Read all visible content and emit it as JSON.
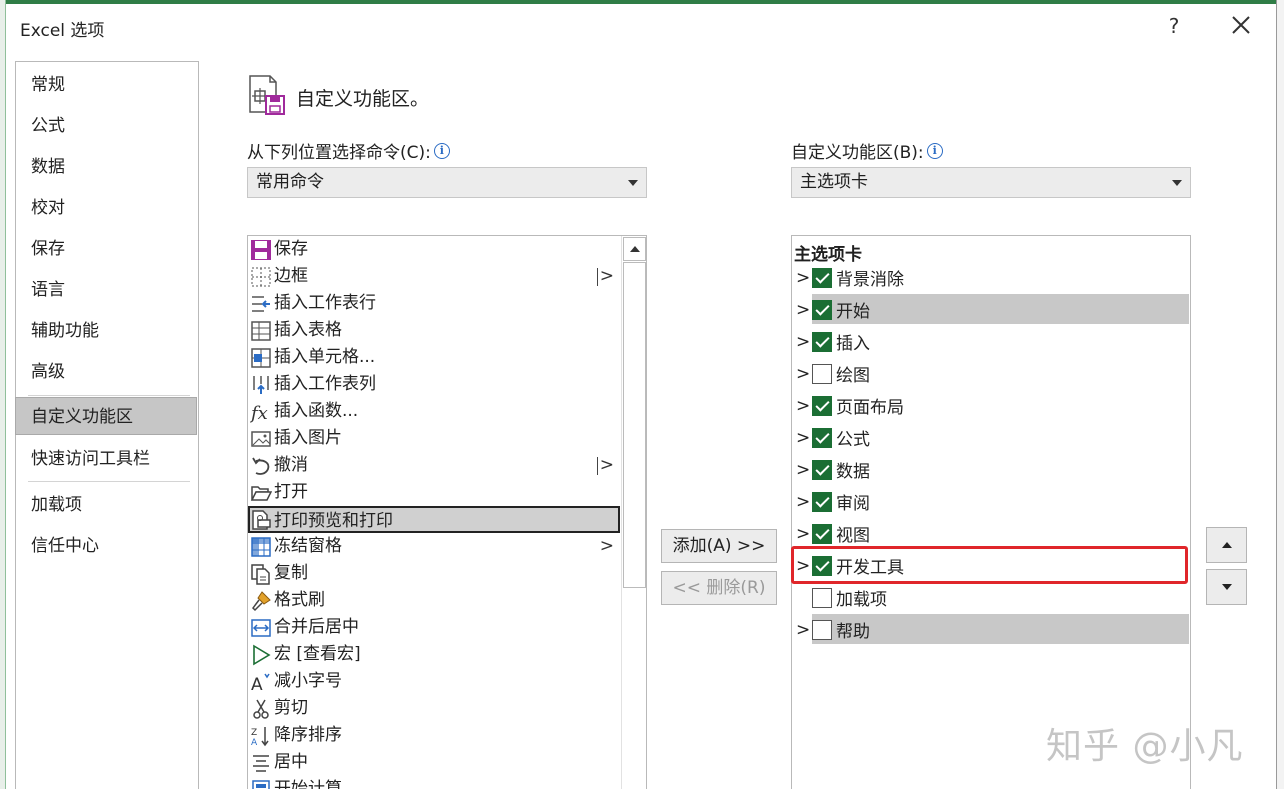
{
  "dialog": {
    "title": "Excel 选项",
    "help": "?"
  },
  "nav": {
    "items": [
      {
        "label": "常规"
      },
      {
        "label": "公式"
      },
      {
        "label": "数据"
      },
      {
        "label": "校对"
      },
      {
        "label": "保存"
      },
      {
        "label": "语言"
      },
      {
        "label": "辅助功能"
      },
      {
        "label": "高级"
      },
      {
        "label": "自定义功能区",
        "active": true
      },
      {
        "label": "快速访问工具栏"
      },
      {
        "label": "加载项"
      },
      {
        "label": "信任中心"
      }
    ]
  },
  "header": {
    "title": "自定义功能区。"
  },
  "left": {
    "label": "从下列位置选择命令(C):",
    "combo_value": "常用命令",
    "commands": [
      {
        "label": "保存",
        "icon": "save-icon"
      },
      {
        "label": "边框",
        "icon": "border-icon",
        "sub": ">",
        "split": true
      },
      {
        "label": "插入工作表行",
        "icon": "insert-row-icon"
      },
      {
        "label": "插入表格",
        "icon": "insert-table-icon"
      },
      {
        "label": "插入单元格...",
        "icon": "insert-cells-icon"
      },
      {
        "label": "插入工作表列",
        "icon": "insert-column-icon"
      },
      {
        "label": "插入函数...",
        "icon": "function-icon"
      },
      {
        "label": "插入图片",
        "icon": "picture-icon"
      },
      {
        "label": "撤消",
        "icon": "undo-icon",
        "sub": ">",
        "split": true
      },
      {
        "label": "打开",
        "icon": "open-folder-icon"
      },
      {
        "label": "打印预览和打印",
        "icon": "print-preview-icon",
        "selected": true
      },
      {
        "label": "冻结窗格",
        "icon": "freeze-panes-icon",
        "sub": ">"
      },
      {
        "label": "复制",
        "icon": "copy-icon"
      },
      {
        "label": "格式刷",
        "icon": "format-painter-icon"
      },
      {
        "label": "合并后居中",
        "icon": "merge-center-icon"
      },
      {
        "label": "宏 [查看宏]",
        "icon": "macro-icon"
      },
      {
        "label": "减小字号",
        "icon": "decrease-font-icon"
      },
      {
        "label": "剪切",
        "icon": "cut-icon"
      },
      {
        "label": "降序排序",
        "icon": "sort-desc-icon"
      },
      {
        "label": "居中",
        "icon": "center-align-icon"
      },
      {
        "label": "开始计算",
        "icon": "calculate-icon"
      }
    ]
  },
  "buttons": {
    "add": "添加(A) >>",
    "remove": "<< 删除(R)"
  },
  "right": {
    "label": "自定义功能区(B):",
    "combo_value": "主选项卡",
    "root": "主选项卡",
    "tabs": [
      {
        "label": "背景消除",
        "checked": true,
        "expander": true
      },
      {
        "label": "开始",
        "checked": true,
        "expander": true,
        "highlight": true
      },
      {
        "label": "插入",
        "checked": true,
        "expander": true
      },
      {
        "label": "绘图",
        "checked": false,
        "expander": true
      },
      {
        "label": "页面布局",
        "checked": true,
        "expander": true
      },
      {
        "label": "公式",
        "checked": true,
        "expander": true
      },
      {
        "label": "数据",
        "checked": true,
        "expander": true
      },
      {
        "label": "审阅",
        "checked": true,
        "expander": true
      },
      {
        "label": "视图",
        "checked": true,
        "expander": true
      },
      {
        "label": "开发工具",
        "checked": true,
        "expander": true
      },
      {
        "label": "加载项",
        "checked": false,
        "expander": false
      },
      {
        "label": "帮助",
        "checked": false,
        "expander": true,
        "highlight": true
      }
    ]
  },
  "watermark": "知乎 @小凡",
  "colors": {
    "accent_green": "#1b6e34",
    "annotation_red": "#e0262a",
    "selection_gray": "#c6c6c6"
  }
}
